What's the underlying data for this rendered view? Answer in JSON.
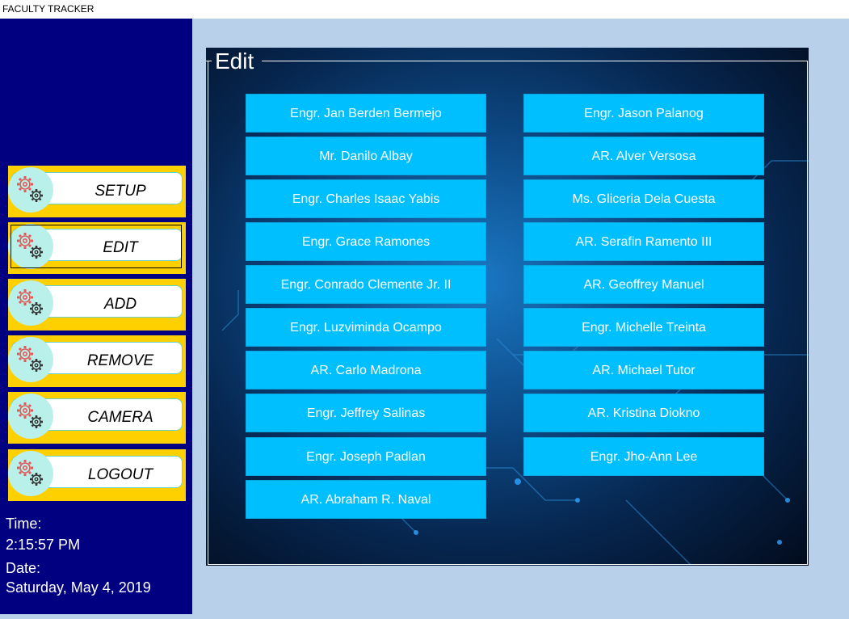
{
  "window": {
    "title": "FACULTY TRACKER"
  },
  "sidebar": {
    "items": [
      {
        "label": "SETUP",
        "selected": false
      },
      {
        "label": "EDIT",
        "selected": true
      },
      {
        "label": "ADD",
        "selected": false
      },
      {
        "label": "REMOVE",
        "selected": false
      },
      {
        "label": "CAMERA",
        "selected": false
      },
      {
        "label": "LOGOUT",
        "selected": false
      }
    ],
    "time_label": "Time:",
    "time_value": "2:15:57 PM",
    "date_label": "Date:",
    "date_value": "Saturday, May 4, 2019"
  },
  "panel": {
    "title": "Edit",
    "left_column": [
      "Engr. Jan Berden Bermejo",
      "Mr. Danilo Albay",
      "Engr. Charles Isaac Yabis",
      "Engr. Grace Ramones",
      "Engr. Conrado Clemente Jr. II",
      "Engr. Luzviminda Ocampo",
      "AR. Carlo Madrona",
      "Engr. Jeffrey Salinas",
      "Engr. Joseph Padlan",
      "AR. Abraham R. Naval"
    ],
    "right_column": [
      "Engr. Jason Palanog",
      "AR. Alver Versosa",
      "Ms. Gliceria Dela Cuesta",
      "AR. Serafin Ramento III",
      "AR. Geoffrey Manuel",
      "Engr. Michelle Treinta",
      "AR. Michael Tutor",
      "AR. Kristina Diokno",
      "Engr. Jho-Ann Lee"
    ]
  },
  "colors": {
    "sidebar_bg": "#000080",
    "nav_button_bg": "#ffd000",
    "faculty_button_bg": "#00bfff",
    "window_bg": "#b8d0ea"
  },
  "icons": {
    "nav_icon": "gears-icon"
  }
}
